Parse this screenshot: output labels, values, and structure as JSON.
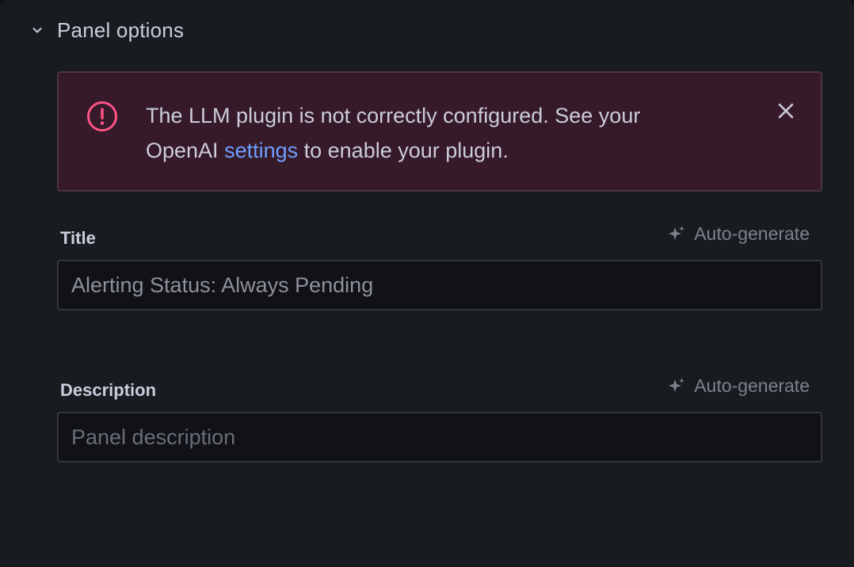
{
  "section": {
    "title": "Panel options"
  },
  "alert": {
    "message_before": "The LLM plugin is not correctly configured. See your OpenAI ",
    "link_text": "settings",
    "message_after": " to enable your plugin.",
    "severity_color": "#ff5286",
    "link_color": "#6e9fff"
  },
  "title_field": {
    "label": "Title",
    "value": "Alerting Status: Always Pending",
    "autogen_label": "Auto-generate"
  },
  "description_field": {
    "label": "Description",
    "placeholder": "Panel description",
    "autogen_label": "Auto-generate"
  },
  "icons": {
    "section_toggle": "chevron-down-icon",
    "alert_icon": "exclamation-circle-icon",
    "alert_close": "close-icon",
    "autogen": "sparkle-icon"
  }
}
